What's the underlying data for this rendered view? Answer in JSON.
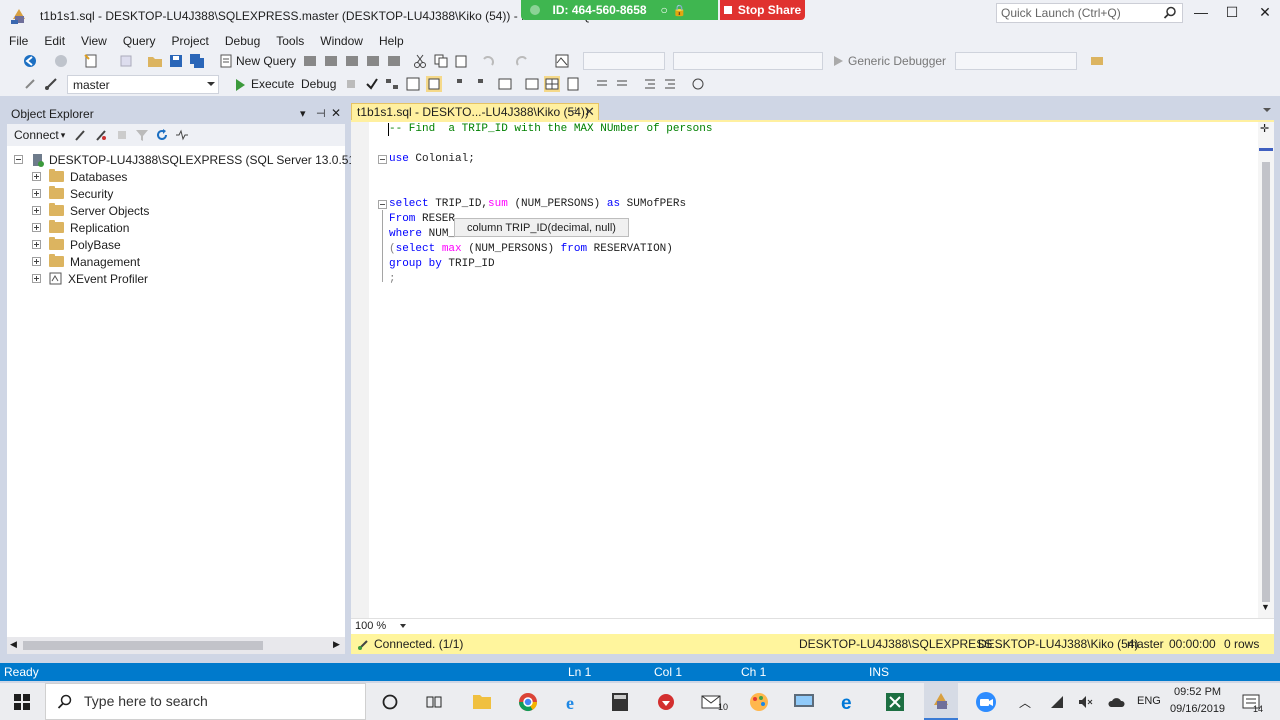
{
  "window": {
    "title": "t1b1s1.sql - DESKTOP-LU4J388\\SQLEXPRESS.master (DESKTOP-LU4J388\\Kiko (54)) - Microsoft SQL",
    "quick_launch_placeholder": "Quick Launch (Ctrl+Q)",
    "minimize": "—",
    "maximize": "☐",
    "close": "✕"
  },
  "share": {
    "id_text": "ID: 464-560-8658",
    "stop_label": "Stop Share",
    "colors": {
      "id_bg": "#3fb650",
      "stop_bg": "#e0322f"
    }
  },
  "menu": [
    "File",
    "Edit",
    "View",
    "Query",
    "Project",
    "Debug",
    "Tools",
    "Window",
    "Help"
  ],
  "toolbar": {
    "new_query": "New Query",
    "debugger": "Generic Debugger",
    "database": "master",
    "execute": "Execute",
    "debug": "Debug"
  },
  "object_explorer": {
    "title": "Object Explorer",
    "connect_label": "Connect",
    "server_node": "DESKTOP-LU4J388\\SQLEXPRESS (SQL Server 13.0.5101 - DESK",
    "children": [
      "Databases",
      "Security",
      "Server Objects",
      "Replication",
      "PolyBase",
      "Management",
      "XEvent Profiler"
    ]
  },
  "document_tab": {
    "label": "t1b1s1.sql - DESKTO...-LU4J388\\Kiko (54))"
  },
  "editor": {
    "comment": "-- Find  a TRIP_ID with the MAX NUmber of persons",
    "use_kw": "use",
    "use_rest": " Colonial;",
    "l4_kw": "select",
    "l4_a": " TRIP_ID,",
    "l4_fn": "sum",
    "l4_b": " (NUM_PERSONS) ",
    "l4_as": "as",
    "l4_c": " SUMofPERs",
    "l5_kw": "From",
    "l5_rest": " RESER",
    "l6_kw": "where",
    "l6_rest": " NUM_",
    "l7_a": "(",
    "l7_kw": "select",
    "l7_fn": " max",
    "l7_b": " (NUM_PERSONS) ",
    "l7_from": "from",
    "l7_c": " RESERVATION)",
    "l8_kw": "group by",
    "l8_rest": " TRIP_ID",
    "l9": ";",
    "tooltip": "column TRIP_ID(decimal, null)",
    "zoom": "100 %"
  },
  "query_status": {
    "connected": "Connected. (1/1)",
    "server": "DESKTOP-LU4J388\\SQLEXPRESS ...",
    "user": "DESKTOP-LU4J388\\Kiko (54)",
    "db": "master",
    "time": "00:00:00",
    "rows": "0 rows"
  },
  "status_bar": {
    "ready": "Ready",
    "ln": "Ln 1",
    "col": "Col 1",
    "ch": "Ch 1",
    "ins": "INS"
  },
  "taskbar": {
    "search_placeholder": "Type here to search",
    "lang": "ENG",
    "time": "09:52 PM",
    "date": "09/16/2019",
    "notif_count": "14",
    "mail_badge": "10"
  },
  "colors": {
    "accent": "#007acc",
    "tab_active": "#fff0a0",
    "query_status_bg": "#fff59d"
  }
}
